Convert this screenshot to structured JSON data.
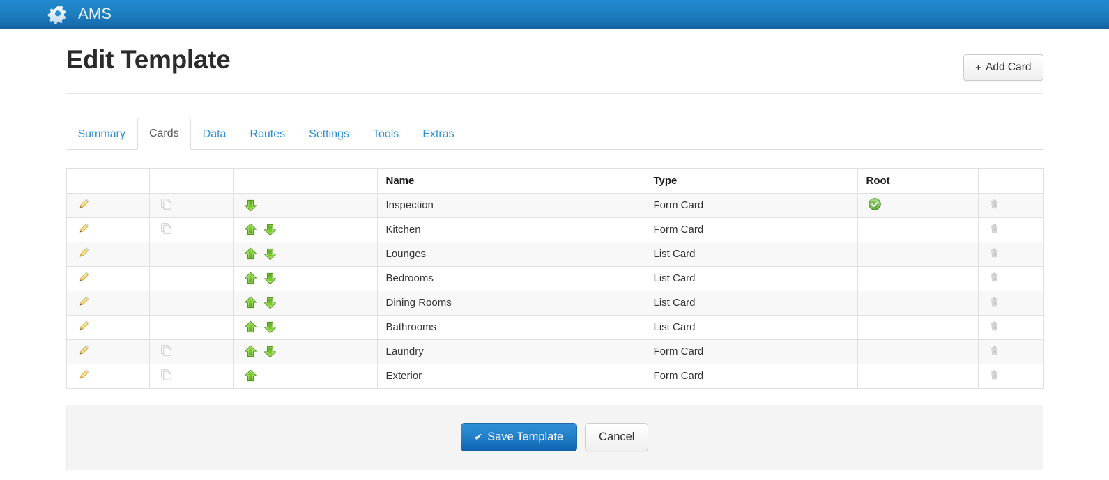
{
  "navbar": {
    "brand": "AMS",
    "gear_icon": "gear-icon",
    "bg_color": "#1e83c6"
  },
  "page": {
    "title": "Edit Template",
    "add_card_button": {
      "label": "Add Card",
      "plus": "+"
    }
  },
  "tabs": [
    {
      "label": "Summary",
      "active": false
    },
    {
      "label": "Cards",
      "active": true
    },
    {
      "label": "Data",
      "active": false
    },
    {
      "label": "Routes",
      "active": false
    },
    {
      "label": "Settings",
      "active": false
    },
    {
      "label": "Tools",
      "active": false
    },
    {
      "label": "Extras",
      "active": false
    }
  ],
  "table": {
    "headers": [
      "",
      "",
      "",
      "Name",
      "Type",
      "Root",
      ""
    ],
    "header_name": "Name",
    "header_type": "Type",
    "header_root": "Root",
    "rows": [
      {
        "name": "Inspection",
        "type": "Form Card",
        "root": true,
        "copy": true,
        "up": false,
        "down": true
      },
      {
        "name": "Kitchen",
        "type": "Form Card",
        "root": false,
        "copy": true,
        "up": true,
        "down": true
      },
      {
        "name": "Lounges",
        "type": "List Card",
        "root": false,
        "copy": false,
        "up": true,
        "down": true
      },
      {
        "name": "Bedrooms",
        "type": "List Card",
        "root": false,
        "copy": false,
        "up": true,
        "down": true
      },
      {
        "name": "Dining Rooms",
        "type": "List Card",
        "root": false,
        "copy": false,
        "up": true,
        "down": true
      },
      {
        "name": "Bathrooms",
        "type": "List Card",
        "root": false,
        "copy": false,
        "up": true,
        "down": true
      },
      {
        "name": "Laundry",
        "type": "Form Card",
        "root": false,
        "copy": true,
        "up": true,
        "down": true
      },
      {
        "name": "Exterior",
        "type": "Form Card",
        "root": false,
        "copy": true,
        "up": true,
        "down": false
      }
    ],
    "icons": {
      "edit": "pencil-icon",
      "copy": "copy-icon",
      "move_up": "arrow-up-icon",
      "move_down": "arrow-down-icon",
      "root": "check-circle-icon",
      "delete": "trash-icon"
    }
  },
  "footer": {
    "save_label": "Save Template",
    "save_check": "✔",
    "cancel_label": "Cancel",
    "save_color": "#2382ca"
  }
}
